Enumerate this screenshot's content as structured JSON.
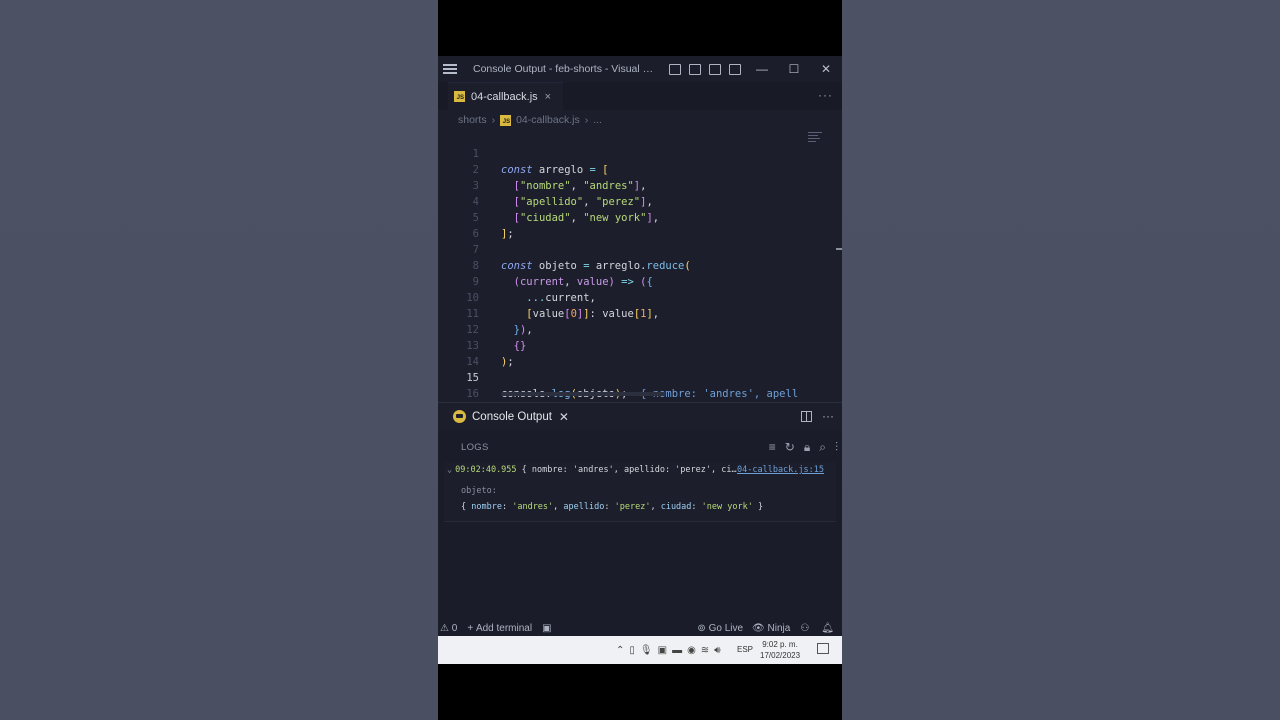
{
  "window": {
    "title": "Console Output - feb-shorts - Visual Studio Code"
  },
  "tabs": [
    {
      "label": "04-callback.js",
      "badge": "JS",
      "close": "×"
    }
  ],
  "breadcrumb": {
    "folder": "shorts",
    "file": "04-callback.js",
    "more": "..."
  },
  "editor": {
    "active_line": 15,
    "lines": [
      {
        "n": "1",
        "text": "const arreglo = ["
      },
      {
        "n": "2",
        "text": "  [\"nombre\", \"andres\"],"
      },
      {
        "n": "3",
        "text": "  [\"apellido\", \"perez\"],"
      },
      {
        "n": "4",
        "text": "  [\"ciudad\", \"new york\"],"
      },
      {
        "n": "5",
        "text": "];"
      },
      {
        "n": "6",
        "text": ""
      },
      {
        "n": "7",
        "text": "const objeto = arreglo.reduce("
      },
      {
        "n": "8",
        "text": "  (current, value) => ({"
      },
      {
        "n": "9",
        "text": "    ...current,"
      },
      {
        "n": "10",
        "text": "    [value[0]]: value[1],"
      },
      {
        "n": "11",
        "text": "  }),"
      },
      {
        "n": "12",
        "text": "  {}"
      },
      {
        "n": "13",
        "text": ");"
      },
      {
        "n": "14",
        "text": ""
      },
      {
        "n": "15",
        "text": "console.log(objeto);"
      },
      {
        "n": "16",
        "text": ""
      }
    ],
    "inline_output": "{ nombre: 'andres', apell"
  },
  "panel": {
    "tab_label": "Console Output",
    "logs_label": "LOGS",
    "entry": {
      "time": "09:02:40.955",
      "summary": " { nombre: 'andres', apellido: 'perez', ci…",
      "source": "04-callback.js:15",
      "var_label": "objeto:",
      "value": "{ nombre: 'andres', apellido: 'perez', ciudad: 'new york' }"
    }
  },
  "statusbar": {
    "problems": "0",
    "add_terminal": "Add terminal",
    "go_live": "Go Live",
    "ninja": "Ninja"
  },
  "taskbar": {
    "lang": "ESP",
    "time": "9:02 p. m.",
    "date": "17/02/2023"
  },
  "colors": {
    "editor_bg": "#1c1f2b",
    "accent": "#4f7bd8",
    "js_badge": "#d9b940"
  }
}
